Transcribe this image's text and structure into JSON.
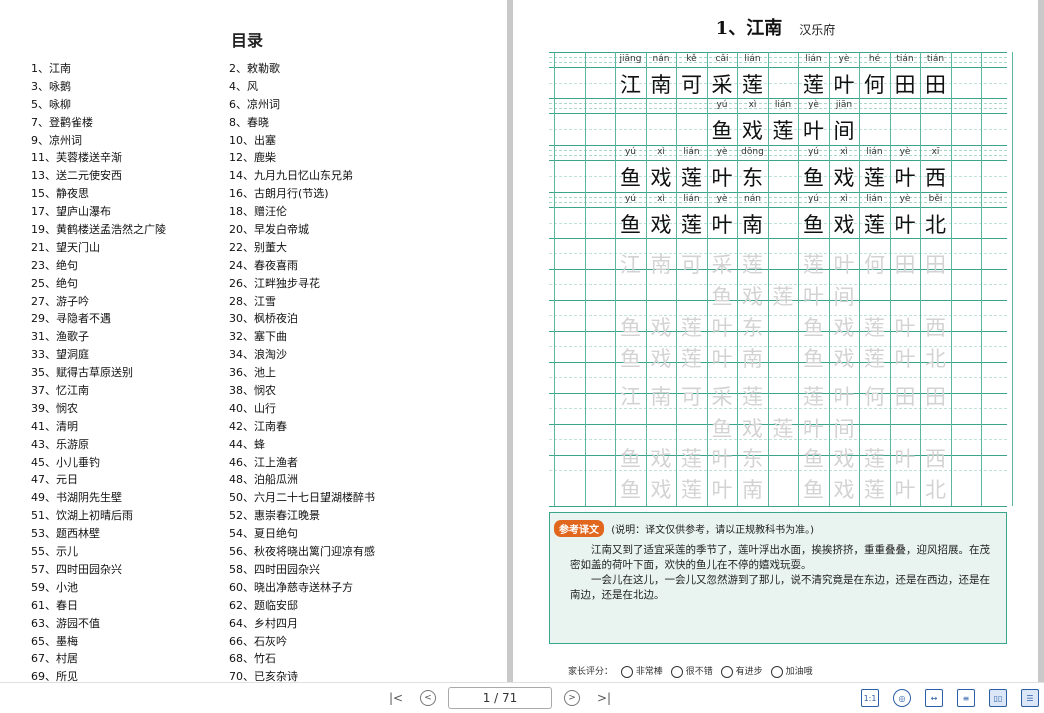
{
  "toc": {
    "title": "目录",
    "items": [
      "1、江南",
      "2、敕勒歌",
      "3、咏鹅",
      "4、风",
      "5、咏柳",
      "6、凉州词",
      "7、登鹳雀楼",
      "8、春晓",
      "9、凉州词",
      "10、出塞",
      "11、芙蓉楼送辛渐",
      "12、鹿柴",
      "13、送二元使安西",
      "14、九月九日忆山东兄弟",
      "15、静夜思",
      "16、古朗月行(节选)",
      "17、望庐山瀑布",
      "18、赠汪伦",
      "19、黄鹤楼送孟浩然之广陵",
      "20、早发白帝城",
      "21、望天门山",
      "22、别董大",
      "23、绝句",
      "24、春夜喜雨",
      "25、绝句",
      "26、江畔独步寻花",
      "27、游子吟",
      "28、江雪",
      "29、寻隐者不遇",
      "30、枫桥夜泊",
      "31、渔歌子",
      "32、塞下曲",
      "33、望洞庭",
      "34、浪淘沙",
      "35、赋得古草原送别",
      "36、池上",
      "37、忆江南",
      "38、悯农",
      "39、悯农",
      "40、山行",
      "41、清明",
      "42、江南春",
      "43、乐游原",
      "44、蜂",
      "45、小儿垂钓",
      "46、江上渔者",
      "47、元日",
      "48、泊船瓜洲",
      "49、书湖阴先生壁",
      "50、六月二十七日望湖楼醉书",
      "51、饮湖上初晴后雨",
      "52、惠崇春江晚景",
      "53、题西林壁",
      "54、夏日绝句",
      "55、示儿",
      "56、秋夜将晓出篱门迎凉有感",
      "57、四时田园杂兴",
      "58、四时田园杂兴",
      "59、小池",
      "60、晓出净慈寺送林子方",
      "61、春日",
      "62、题临安邸",
      "63、游园不值",
      "64、乡村四月",
      "65、墨梅",
      "66、石灰吟",
      "67、村居",
      "68、竹石",
      "69、所见",
      "70、已亥杂诗"
    ]
  },
  "poem": {
    "title": "1、江南",
    "author": "汉乐府",
    "lines": [
      {
        "row": 0,
        "col_start": 2,
        "chars": [
          "江",
          "南",
          "可",
          "采",
          "莲"
        ],
        "pinyin": [
          "jiāng",
          "nán",
          "kě",
          "cǎi",
          "lián"
        ]
      },
      {
        "row": 0,
        "col_start": 8,
        "chars": [
          "莲",
          "叶",
          "何",
          "田",
          "田"
        ],
        "pinyin": [
          "lián",
          "yè",
          "hé",
          "tián",
          "tián"
        ]
      },
      {
        "row": 1,
        "col_start": 5,
        "chars": [
          "鱼",
          "戏",
          "莲",
          "叶",
          "间"
        ],
        "pinyin": [
          "yú",
          "xì",
          "lián",
          "yè",
          "jiān"
        ]
      },
      {
        "row": 2,
        "col_start": 2,
        "chars": [
          "鱼",
          "戏",
          "莲",
          "叶",
          "东"
        ],
        "pinyin": [
          "yú",
          "xì",
          "lián",
          "yè",
          "dōng"
        ]
      },
      {
        "row": 2,
        "col_start": 8,
        "chars": [
          "鱼",
          "戏",
          "莲",
          "叶",
          "西"
        ],
        "pinyin": [
          "yú",
          "xì",
          "lián",
          "yè",
          "xī"
        ]
      },
      {
        "row": 3,
        "col_start": 2,
        "chars": [
          "鱼",
          "戏",
          "莲",
          "叶",
          "南"
        ],
        "pinyin": [
          "yú",
          "xì",
          "lián",
          "yè",
          "nán"
        ]
      },
      {
        "row": 3,
        "col_start": 8,
        "chars": [
          "鱼",
          "戏",
          "莲",
          "叶",
          "北"
        ],
        "pinyin": [
          "yú",
          "xì",
          "lián",
          "yè",
          "běi"
        ]
      }
    ]
  },
  "translation": {
    "badge": "参考译文",
    "note": "(说明：译文仅供参考，请以正规教科书为准。)",
    "paragraphs": [
      "江南又到了适宜采莲的季节了，莲叶浮出水面，挨挨挤挤，重重叠叠，迎风招展。在茂密如盖的荷叶下面，欢快的鱼儿在不停的嬉戏玩耍。",
      "一会儿在这儿，一会儿又忽然游到了那儿，说不清究竟是在东边，还是在西边，还是在南边，还是在北边。"
    ]
  },
  "rating": {
    "label": "家长评分：",
    "options": [
      "非常棒",
      "很不错",
      "有进步",
      "加油哦"
    ]
  },
  "toolbar": {
    "first_page": "|<",
    "prev": "<",
    "page_indicator": "1 / 71",
    "next": ">",
    "last_page": ">|",
    "view_actual_size": "1:1"
  }
}
